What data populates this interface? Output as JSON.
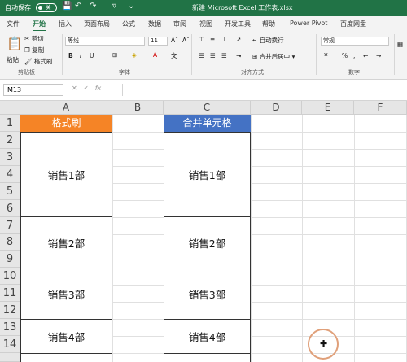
{
  "titlebar": {
    "autosave_label": "自动保存",
    "toggle_label": "关",
    "document_title": "新建 Microsoft Excel 工作表.xlsx"
  },
  "tabs": [
    "文件",
    "开始",
    "插入",
    "页面布局",
    "公式",
    "数据",
    "审阅",
    "视图",
    "开发工具",
    "帮助",
    "Power Pivot",
    "百度网盘"
  ],
  "active_tab": "开始",
  "ribbon": {
    "clipboard": {
      "paste": "粘贴",
      "cut": "剪切",
      "copy": "复制",
      "format_painter": "格式刷",
      "group": "剪贴板"
    },
    "font": {
      "font_name": "等线",
      "font_size": "11",
      "group": "字体"
    },
    "alignment": {
      "wrap_text": "自动换行",
      "merge_center": "合并后居中",
      "group": "对齐方式"
    },
    "number": {
      "format": "常规",
      "group": "数字"
    }
  },
  "formula_bar": {
    "name_box": "M13",
    "formula": ""
  },
  "columns": [
    "A",
    "B",
    "C",
    "D",
    "E",
    "F"
  ],
  "rows": [
    "1",
    "2",
    "3",
    "4",
    "5",
    "6",
    "7",
    "8",
    "9",
    "10",
    "11",
    "12",
    "13",
    "14"
  ],
  "cells": {
    "a1": "格式刷",
    "c1": "合并单元格",
    "a_blocks": [
      "销售1部",
      "销售2部",
      "销售3部",
      "销售4部"
    ],
    "c_blocks": [
      "销售1部",
      "销售2部",
      "销售3部",
      "销售4部"
    ]
  },
  "colors": {
    "excel_green": "#217346",
    "a1_fill": "#f58426",
    "c1_fill": "#4472c4"
  }
}
